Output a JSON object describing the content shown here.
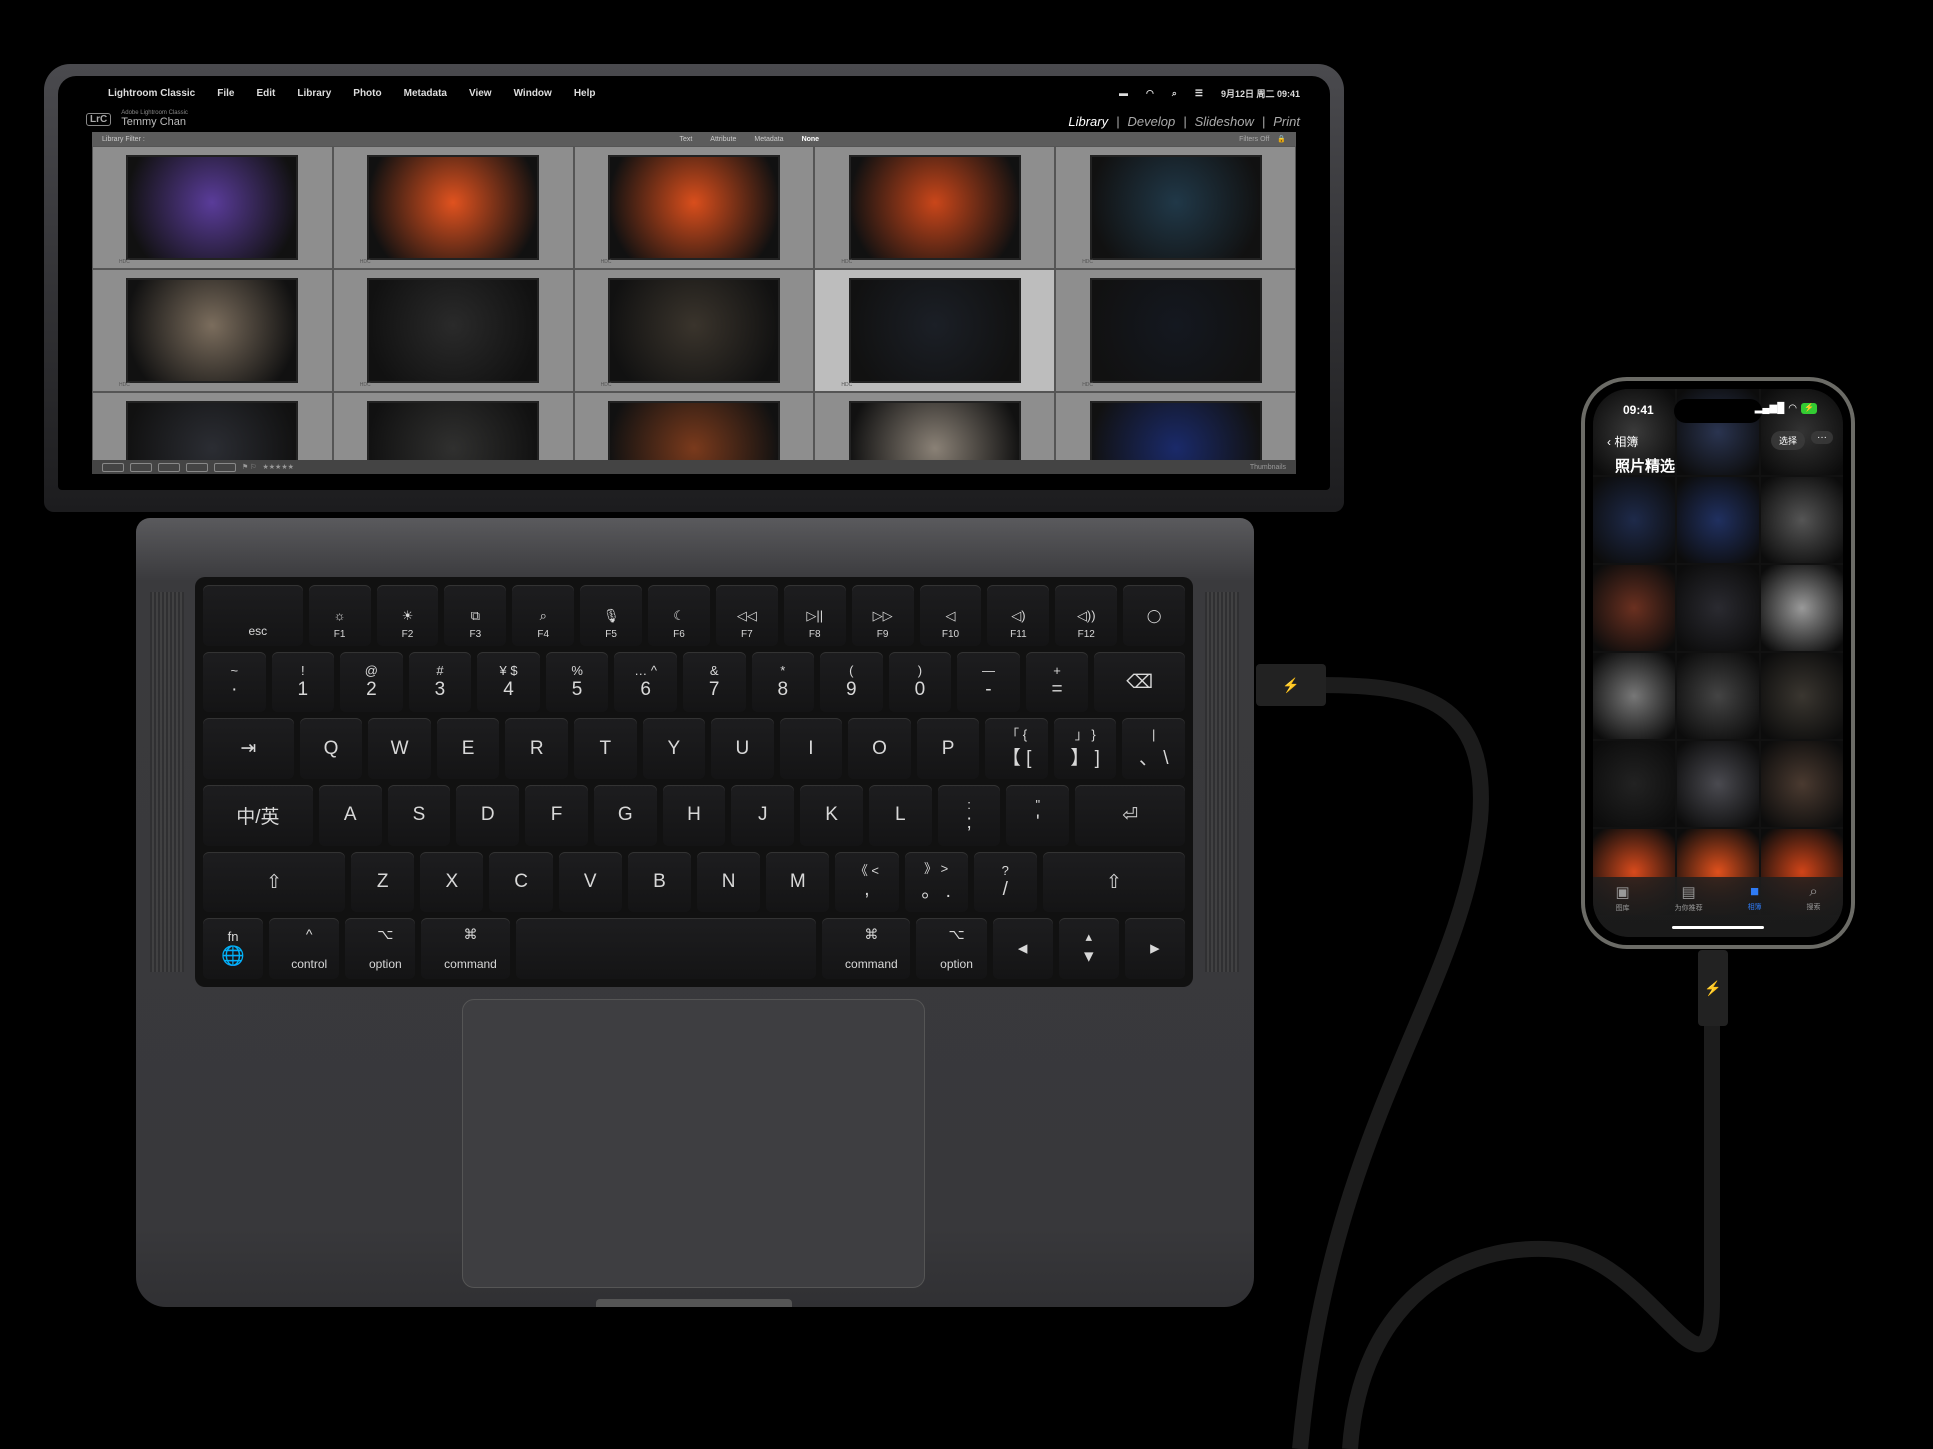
{
  "menubar": {
    "apple": "",
    "app": "Lightroom Classic",
    "items": [
      "File",
      "Edit",
      "Library",
      "Photo",
      "Metadata",
      "View",
      "Window",
      "Help"
    ],
    "datetime": "9月12日 周二 09:41"
  },
  "lightroom": {
    "logo": "LrC",
    "product": "Adobe Lightroom Classic",
    "user": "Temmy Chan",
    "modules": [
      "Library",
      "Develop",
      "Slideshow",
      "Print"
    ],
    "active_module": "Library",
    "filter": {
      "label": "Library Filter :",
      "options": [
        "Text",
        "Attribute",
        "Metadata",
        "None"
      ],
      "active": "None",
      "status": "Filters Off"
    },
    "thumb_badge": "HDC",
    "photos": [
      {
        "tone": "#5a3c9a"
      },
      {
        "tone": "#e0521f"
      },
      {
        "tone": "#d94e1c"
      },
      {
        "tone": "#c9461a"
      },
      {
        "tone": "#203848"
      },
      {
        "tone": "#7b6d5d"
      },
      {
        "tone": "#2a2a2a"
      },
      {
        "tone": "#3a342c"
      },
      {
        "tone": "#1b1f26",
        "selected": true
      },
      {
        "tone": "#141820"
      },
      {
        "tone": "#2b2d33"
      },
      {
        "tone": "#30302f"
      },
      {
        "tone": "#7a3a1c"
      },
      {
        "tone": "#8a8176"
      },
      {
        "tone": "#1a2a6a"
      }
    ],
    "footer": {
      "stars": "★★★★★",
      "thumbnails_label": "Thumbnails"
    }
  },
  "keyboard": {
    "rows": [
      [
        {
          "b": "esc"
        },
        {
          "t": "☼",
          "b": "F1"
        },
        {
          "t": "☀",
          "b": "F2"
        },
        {
          "t": "⧉",
          "b": "F3"
        },
        {
          "t": "⌕",
          "b": "F4"
        },
        {
          "t": "🎙",
          "b": "F5"
        },
        {
          "t": "☾",
          "b": "F6"
        },
        {
          "t": "◁◁",
          "b": "F7"
        },
        {
          "t": "▷||",
          "b": "F8"
        },
        {
          "t": "▷▷",
          "b": "F9"
        },
        {
          "t": "◁",
          "b": "F10"
        },
        {
          "t": "◁)",
          "b": "F11"
        },
        {
          "t": "◁))",
          "b": "F12"
        },
        {
          "t": "◯",
          "b": ""
        }
      ],
      [
        {
          "t": "~",
          "b": "·"
        },
        {
          "t": "!",
          "b": "1"
        },
        {
          "t": "@",
          "b": "2"
        },
        {
          "t": "#",
          "b": "3"
        },
        {
          "t": "¥ $",
          "b": "4"
        },
        {
          "t": "%",
          "b": "5"
        },
        {
          "t": "… ^",
          "b": "6"
        },
        {
          "t": "&",
          "b": "7"
        },
        {
          "t": "*",
          "b": "8"
        },
        {
          "t": "(",
          "b": "9"
        },
        {
          "t": ")",
          "b": "0"
        },
        {
          "t": "—",
          "b": "-"
        },
        {
          "t": "+",
          "b": "="
        },
        {
          "b": "⌫"
        }
      ],
      [
        {
          "b": "⇥"
        },
        {
          "b": "Q"
        },
        {
          "b": "W"
        },
        {
          "b": "E"
        },
        {
          "b": "R"
        },
        {
          "b": "T"
        },
        {
          "b": "Y"
        },
        {
          "b": "U"
        },
        {
          "b": "I"
        },
        {
          "b": "O"
        },
        {
          "b": "P"
        },
        {
          "t": "「 {",
          "b": "【 ["
        },
        {
          "t": "」 }",
          "b": "】 ]"
        },
        {
          "t": "|",
          "b": "、 \\"
        }
      ],
      [
        {
          "b": "中/英"
        },
        {
          "b": "A"
        },
        {
          "b": "S"
        },
        {
          "b": "D"
        },
        {
          "b": "F"
        },
        {
          "b": "G"
        },
        {
          "b": "H"
        },
        {
          "b": "J"
        },
        {
          "b": "K"
        },
        {
          "b": "L"
        },
        {
          "t": ":",
          "b": ";"
        },
        {
          "t": "\"",
          "b": "'"
        },
        {
          "b": "⏎"
        }
      ],
      [
        {
          "b": "⇧"
        },
        {
          "b": "Z"
        },
        {
          "b": "X"
        },
        {
          "b": "C"
        },
        {
          "b": "V"
        },
        {
          "b": "B"
        },
        {
          "b": "N"
        },
        {
          "b": "M"
        },
        {
          "t": "《 <",
          "b": ","
        },
        {
          "t": "》 >",
          "b": "。 ."
        },
        {
          "t": "?",
          "b": "/"
        },
        {
          "b": "⇧"
        }
      ],
      [
        {
          "t": "fn",
          "b": "🌐"
        },
        {
          "t": "^",
          "b": "control"
        },
        {
          "t": "⌥",
          "b": "option"
        },
        {
          "t": "⌘",
          "b": "command"
        },
        {
          "b": ""
        },
        {
          "t": "⌘",
          "b": "command"
        },
        {
          "t": "⌥",
          "b": "option"
        },
        {
          "b": "◂"
        },
        {
          "t": "▴",
          "b": "▾"
        },
        {
          "b": "▸"
        }
      ]
    ]
  },
  "phone": {
    "time": "09:41",
    "back": "‹ 相簿",
    "title": "照片精选",
    "select": "选择",
    "more": "···",
    "signal": "▂▄▆█",
    "wifi": "◠",
    "battery": "⚡",
    "photos": [
      "#3a3a3a",
      "#2a3450",
      "#333",
      "#1e2a4a",
      "#203060",
      "#555",
      "#6a3020",
      "#2a2a30",
      "#999",
      "#777",
      "#444",
      "#3a3630",
      "#222",
      "#4a4a50",
      "#4a3a30",
      "#d84a1c",
      "#e0501c",
      "#d04418"
    ],
    "tabs": [
      {
        "icon": "▣",
        "label": "图库"
      },
      {
        "icon": "▤",
        "label": "为你推荐"
      },
      {
        "icon": "■",
        "label": "相簿",
        "active": true
      },
      {
        "icon": "⌕",
        "label": "搜索"
      }
    ],
    "accent": "#2f7bf5"
  },
  "cable": {
    "icon": "⚡"
  }
}
